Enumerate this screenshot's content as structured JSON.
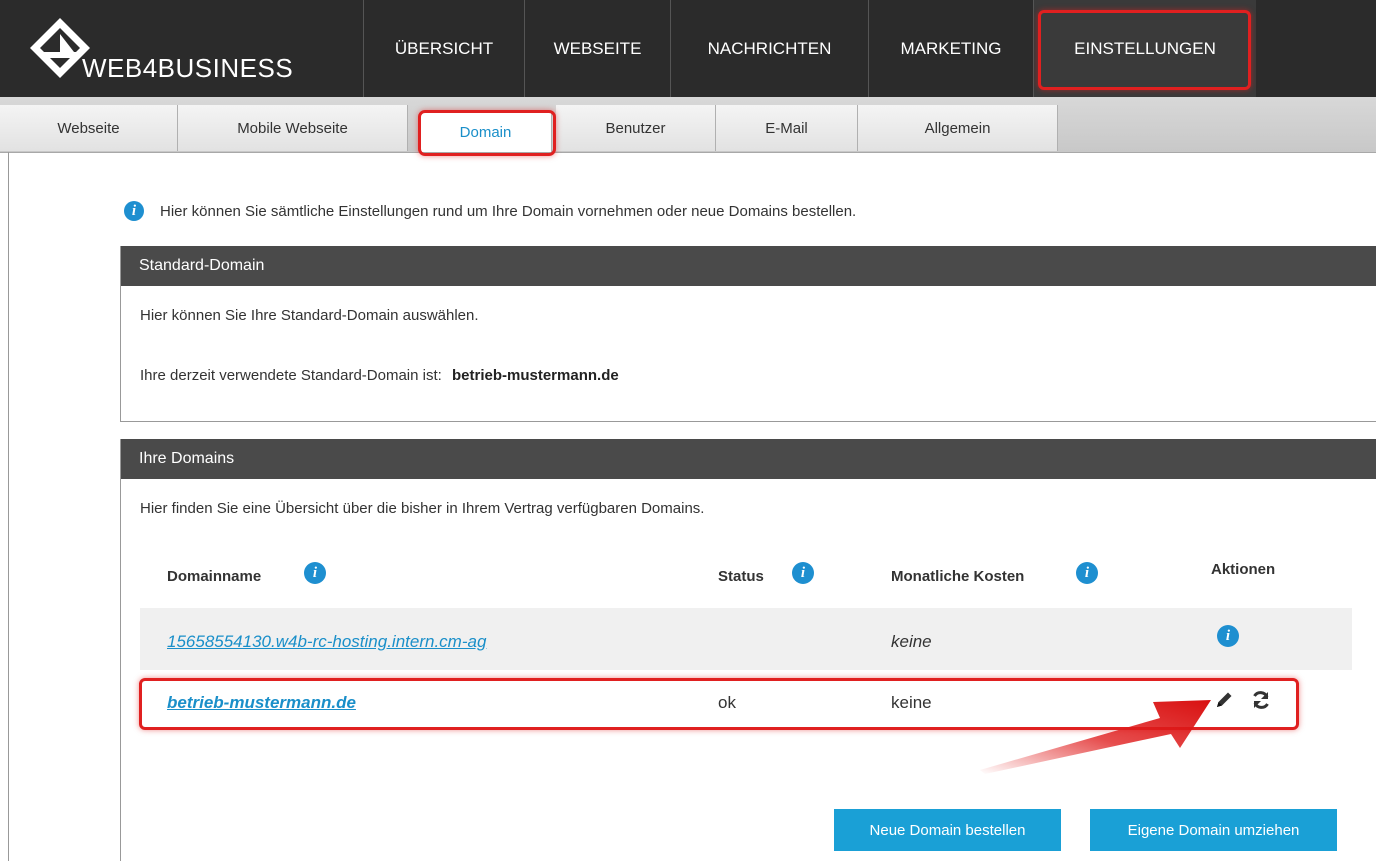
{
  "brand": {
    "name": "WEB4BUSINESS"
  },
  "nav": [
    {
      "label": "ÜBERSICHT"
    },
    {
      "label": "WEBSEITE"
    },
    {
      "label": "NACHRICHTEN"
    },
    {
      "label": "MARKETING"
    },
    {
      "label": "EINSTELLUNGEN",
      "active": true
    }
  ],
  "tabs": [
    {
      "label": "Webseite"
    },
    {
      "label": "Mobile Webseite"
    },
    {
      "label": "Domain",
      "active": true
    },
    {
      "label": "Benutzer"
    },
    {
      "label": "E-Mail"
    },
    {
      "label": "Allgemein"
    }
  ],
  "intro": "Hier können Sie sämtliche Einstellungen rund um Ihre Domain vornehmen oder neue Domains bestellen.",
  "standard": {
    "title": "Standard-Domain",
    "desc": "Hier können Sie Ihre Standard-Domain auswählen.",
    "current_label": "Ihre derzeit verwendete Standard-Domain ist:",
    "current_value": "betrieb-mustermann.de"
  },
  "domains": {
    "title": "Ihre Domains",
    "desc": "Hier finden Sie eine Übersicht über die bisher in Ihrem Vertrag verfügbaren Domains.",
    "columns": [
      "Domainname",
      "Status",
      "Monatliche Kosten",
      "Aktionen"
    ],
    "rows": [
      {
        "name": "15658554130.w4b-rc-hosting.intern.cm-ag",
        "status": "",
        "cost": "keine"
      },
      {
        "name": "betrieb-mustermann.de",
        "status": "ok",
        "cost": "keine"
      }
    ],
    "buttons": {
      "order": "Neue Domain bestellen",
      "transfer": "Eigene Domain umziehen"
    }
  },
  "colors": {
    "accent": "#1a8fc9",
    "button": "#1aa0d6",
    "header": "#2b2b2b",
    "highlight": "#e02020"
  }
}
